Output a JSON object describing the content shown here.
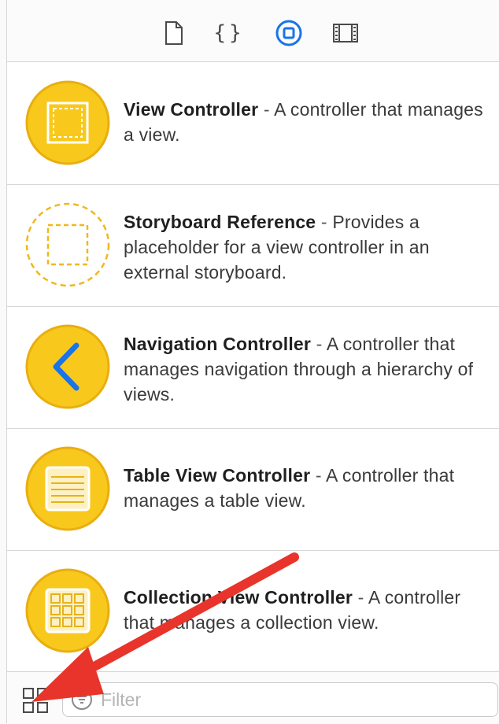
{
  "toolbar": {
    "tabs": [
      {
        "name": "file-inspector",
        "icon": "document-icon"
      },
      {
        "name": "quick-help",
        "icon": "curly-braces-icon"
      },
      {
        "name": "object-library",
        "icon": "object-library-icon",
        "selected": true
      },
      {
        "name": "media-library",
        "icon": "film-strip-icon"
      }
    ],
    "code_glyph": "{}",
    "accent_color": "#1a73e8"
  },
  "library": {
    "items": [
      {
        "title": "View Controller",
        "separator": " - ",
        "description": "A controller that manages a view.",
        "icon": "view-controller-icon"
      },
      {
        "title": "Storyboard Reference",
        "separator": " - ",
        "description": "Provides a placeholder for a view controller in an external storyboard.",
        "icon": "storyboard-reference-icon"
      },
      {
        "title": "Navigation Controller",
        "separator": " - ",
        "description": "A controller that manages navigation through a hierarchy of views.",
        "icon": "navigation-controller-icon"
      },
      {
        "title": "Table View Controller",
        "separator": " - ",
        "description": "A controller that manages a table view.",
        "icon": "table-view-controller-icon"
      },
      {
        "title": "Collection View Controller",
        "separator": " - ",
        "description": "A controller that manages a collection view.",
        "icon": "collection-view-controller-icon"
      }
    ],
    "icon_color": "#f8c91c",
    "icon_border_color": "#e9ae10"
  },
  "bottom": {
    "filter_placeholder": "Filter",
    "filter_value": "",
    "grid_icon": "grid-view-icon",
    "annotation_arrow_color": "#e8342a"
  }
}
